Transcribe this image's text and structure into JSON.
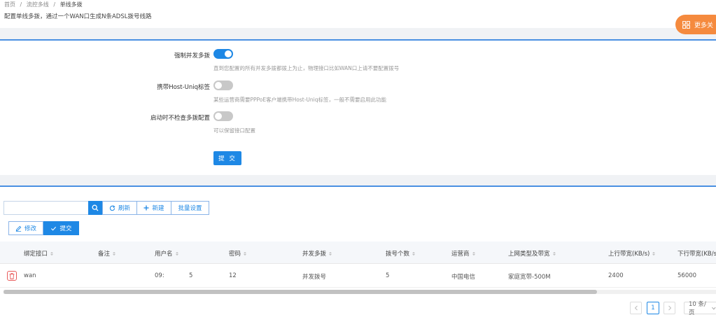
{
  "breadcrumb": {
    "home": "首页",
    "sep": "/",
    "parent": "流控多线",
    "current": "单线多拨"
  },
  "subtitle": "配置单线多拨，通过一个WAN口生成N条ADSL拨号线路",
  "more_button": {
    "label": "更多关",
    "icon": "grid-icon",
    "color": "#f58a3e"
  },
  "accent": "#1e88e5",
  "settings": [
    {
      "label": "强制并发多拨",
      "enabled": true,
      "description": "直到您配置的所有并发多拨都拨上为止，物理接口比如WAN口上请不要配置拨号"
    },
    {
      "label": "携带Host-Uniq标签",
      "enabled": false,
      "description": "某些运营商需要PPPoE客户端携带Host-Uniq标签，一般不需要启用此功能"
    },
    {
      "label": "启动时不检查多拨配置",
      "enabled": false,
      "description": "可以保留接口配置"
    }
  ],
  "submit_label": "提 交",
  "toolbar": {
    "search_value": "",
    "refresh_label": "刷新",
    "new_label": "新建",
    "batch_label": "批量设置",
    "edit_label": "修改",
    "submit_label": "提交"
  },
  "table": {
    "columns": [
      "绑定接口",
      "备注",
      "用户名",
      "密码",
      "并发多拨",
      "拨号个数",
      "运营商",
      "上网类型及带宽",
      "上行带宽(KB/s)",
      "下行带宽(KB/s"
    ],
    "rows": [
      {
        "interface": "wan",
        "remark": "",
        "username": "09:",
        "username2": "5",
        "password": "12",
        "concurrent": "并发拨号",
        "count": "5",
        "isp": "中国电信",
        "net_type": "家庭宽带-500M",
        "upload": "2400",
        "download": "56000"
      }
    ]
  },
  "pagination": {
    "current_page": "1",
    "page_size": "10 条/页"
  }
}
